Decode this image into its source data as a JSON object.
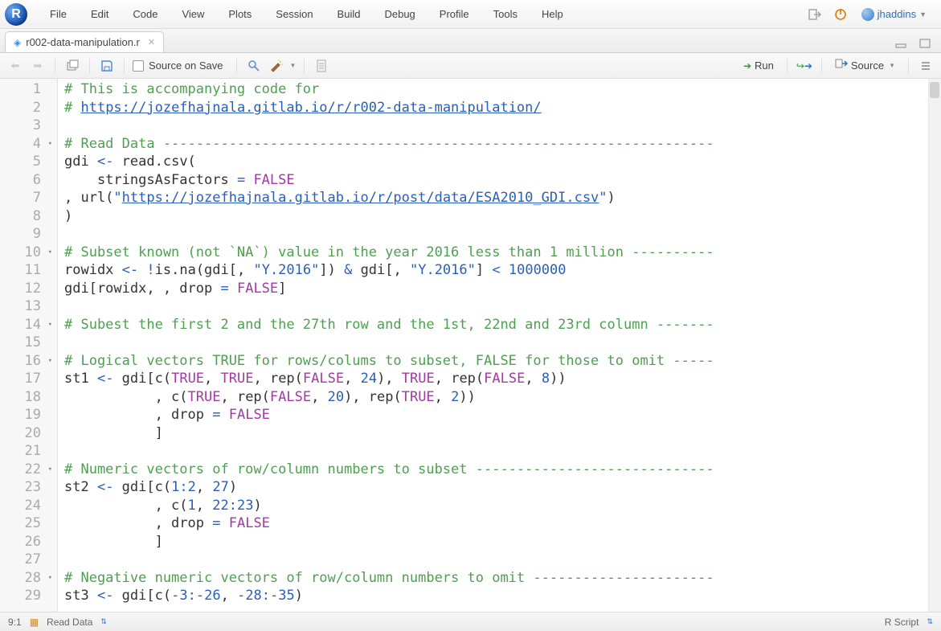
{
  "menubar": {
    "items": [
      "File",
      "Edit",
      "Code",
      "View",
      "Plots",
      "Session",
      "Build",
      "Debug",
      "Profile",
      "Tools",
      "Help"
    ],
    "user": "jhaddins"
  },
  "tab": {
    "filename": "r002-data-manipulation.r"
  },
  "toolbar": {
    "source_on_save": "Source on Save",
    "run": "Run",
    "source": "Source"
  },
  "statusbar": {
    "pos": "9:1",
    "section": "Read Data",
    "filetype": "R Script"
  },
  "code": {
    "line_count": 29,
    "fold_lines": [
      4,
      10,
      14,
      16,
      22,
      28
    ],
    "lines": {
      "l1": {
        "comment_prefix": "# This is accompanying code for"
      },
      "l2": {
        "comment_prefix": "# ",
        "link": "https://jozefhajnala.gitlab.io/r/r002-data-manipulation/"
      },
      "l3": {
        "text": ""
      },
      "l4": {
        "comment": "# Read Data -------------------------------------------------------------------"
      },
      "l5": {
        "a": "gdi ",
        "op": "<-",
        "b": " read.csv("
      },
      "l6": {
        "a": "    stringsAsFactors ",
        "op": "=",
        "b": " ",
        "const": "FALSE"
      },
      "l7": {
        "a": ", url(",
        "q": "\"",
        "link": "https://jozefhajnala.gitlab.io/r/post/data/ESA2010_GDI.csv",
        "q2": "\"",
        "b": ")"
      },
      "l8": {
        "text": ")"
      },
      "l9": {
        "text": ""
      },
      "l10": {
        "comment": "# Subset known (not `NA`) value in the year 2016 less than 1 million ----------"
      },
      "l11": {
        "a": "rowidx ",
        "op1": "<-",
        "b": " ",
        "op2": "!",
        "c": "is.na(gdi[, ",
        "s1": "\"Y.2016\"",
        "d": "]) ",
        "op3": "&",
        "e": " gdi[, ",
        "s2": "\"Y.2016\"",
        "f": "] ",
        "op4": "<",
        "g": " ",
        "n": "1000000"
      },
      "l12": {
        "a": "gdi[rowidx, , drop ",
        "op": "=",
        "b": " ",
        "const": "FALSE",
        "c": "]"
      },
      "l13": {
        "text": ""
      },
      "l14": {
        "comment": "# Subest the first 2 and the 27th row and the 1st, 22nd and 23rd column -------"
      },
      "l15": {
        "text": ""
      },
      "l16": {
        "comment": "# Logical vectors TRUE for rows/colums to subset, FALSE for those to omit -----"
      },
      "l17": {
        "a": "st1 ",
        "op": "<-",
        "b": " gdi[c(",
        "c1": "TRUE",
        "c": ", ",
        "c2": "TRUE",
        "d": ", rep(",
        "c3": "FALSE",
        "e": ", ",
        "n1": "24",
        "f": "), ",
        "c4": "TRUE",
        "g": ", rep(",
        "c5": "FALSE",
        "h": ", ",
        "n2": "8",
        "i": "))"
      },
      "l18": {
        "a": "           , c(",
        "c1": "TRUE",
        "b": ", rep(",
        "c2": "FALSE",
        "c": ", ",
        "n1": "20",
        "d": "), rep(",
        "c3": "TRUE",
        "e": ", ",
        "n2": "2",
        "f": "))"
      },
      "l19": {
        "a": "           , drop ",
        "op": "=",
        "b": " ",
        "const": "FALSE"
      },
      "l20": {
        "text": "           ]"
      },
      "l21": {
        "text": ""
      },
      "l22": {
        "comment": "# Numeric vectors of row/column numbers to subset -----------------------------"
      },
      "l23": {
        "a": "st2 ",
        "op": "<-",
        "b": " gdi[c(",
        "n1": "1",
        "c": ":",
        "n2": "2",
        "d": ", ",
        "n3": "27",
        "e": ")"
      },
      "l24": {
        "a": "           , c(",
        "n1": "1",
        "b": ", ",
        "n2": "22",
        "c": ":",
        "n3": "23",
        "d": ")"
      },
      "l25": {
        "a": "           , drop ",
        "op": "=",
        "b": " ",
        "const": "FALSE"
      },
      "l26": {
        "text": "           ]"
      },
      "l27": {
        "text": ""
      },
      "l28": {
        "comment": "# Negative numeric vectors of row/column numbers to omit ----------------------"
      },
      "l29": {
        "a": "st3 ",
        "op": "<-",
        "b": " gdi[c(",
        "op2": "-",
        "n1": "3",
        "c": ":",
        "op3": "-",
        "n2": "26",
        "d": ", ",
        "op4": "-",
        "n3": "28",
        "e": ":",
        "op5": "-",
        "n4": "35",
        "f": ")"
      }
    }
  }
}
